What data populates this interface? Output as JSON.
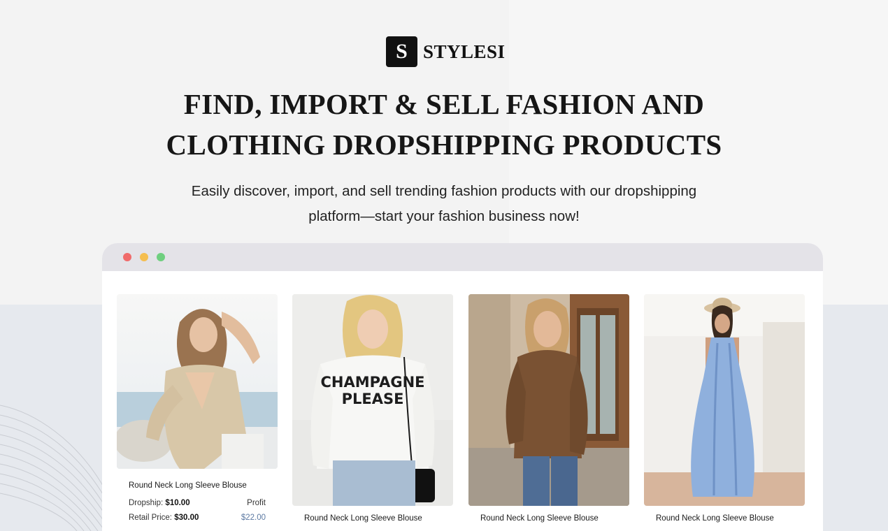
{
  "brand": {
    "mark": "S",
    "name": "STYLESI"
  },
  "hero": {
    "headline_line1": "FIND, IMPORT & SELL FASHION AND",
    "headline_line2": "CLOTHING DROPSHIPPING PRODUCTS",
    "subline_line1": "Easily discover, import, and sell trending fashion products with our dropshipping",
    "subline_line2": "platform—start your fashion business now!"
  },
  "window_controls": {
    "close_color": "#f06b6b",
    "minimize_color": "#f5be4f",
    "maximize_color": "#6fcf7f"
  },
  "products": [
    {
      "title": "Round Neck Long Sleeve Blouse",
      "dropship_label": "Dropship:",
      "dropship_price": "$10.00",
      "profit_label": "Profit",
      "retail_label": "Retail Price:",
      "retail_price": "$30.00",
      "profit_value": "$22.00",
      "image": "woman-beige-wrap-blouse-photo"
    },
    {
      "title": "Round Neck Long Sleeve Blouse",
      "image": "woman-champagne-please-sweater-photo",
      "print": [
        "CHAMPAGNE",
        "PLEASE"
      ]
    },
    {
      "title": "Round Neck Long Sleeve Blouse",
      "image": "woman-brown-turtleneck-sweater-photo"
    },
    {
      "title": "Round Neck Long Sleeve Blouse",
      "image": "woman-blue-maxi-dress-photo"
    }
  ],
  "colors": {
    "profit_value": "#5d7aa3",
    "logo_bg": "#111111",
    "titlebar": "#e4e3e8"
  }
}
